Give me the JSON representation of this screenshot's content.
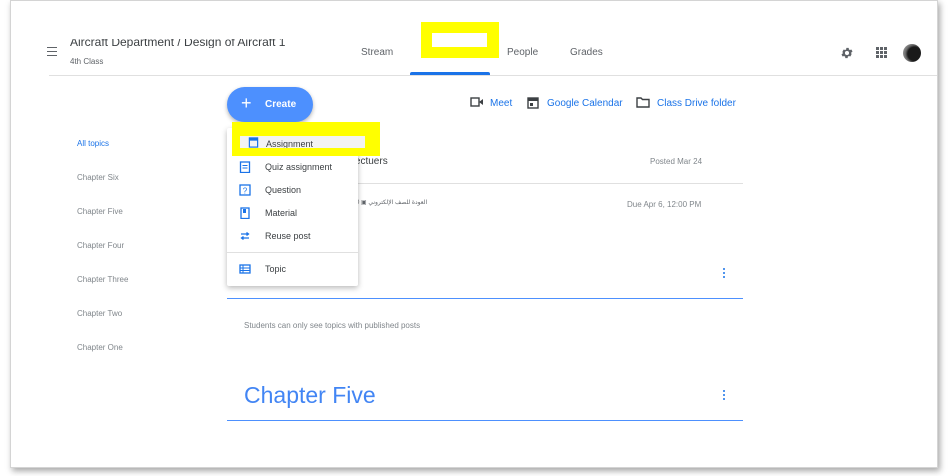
{
  "header": {
    "class_title": "Aircraft Department / Design of Aircraft 1",
    "class_subtitle": "4th Class",
    "tabs": {
      "stream": "Stream",
      "people": "People",
      "grades": "Grades"
    }
  },
  "create": {
    "label": "Create"
  },
  "links": {
    "meet": "Meet",
    "calendar": "Google Calendar",
    "drive": "Class Drive folder"
  },
  "topics": [
    "All topics",
    "Chapter Six",
    "Chapter Five",
    "Chapter Four",
    "Chapter Three",
    "Chapter Two",
    "Chapter One"
  ],
  "menu": {
    "items": [
      {
        "label": "Assignment",
        "icon": "assignment-icon"
      },
      {
        "label": "Quiz assignment",
        "icon": "quiz-icon"
      },
      {
        "label": "Question",
        "icon": "question-icon"
      },
      {
        "label": "Material",
        "icon": "material-icon"
      },
      {
        "label": "Reuse post",
        "icon": "reuse-icon"
      },
      {
        "label": "Topic",
        "icon": "topic-icon"
      }
    ]
  },
  "post": {
    "title_fragment": "o Lectuers",
    "posted": "Posted Mar 24",
    "arabic_line": "العودة للصف الإلكتروني",
    "arabic_count": "0",
    "due": "Due Apr 6, 12:00 PM"
  },
  "notice": "Students can only see topics with published posts",
  "section": {
    "heading": "Chapter Five"
  },
  "colors": {
    "accent": "#1a73e8",
    "create_button": "#4d90fe",
    "highlight": "#ffff00"
  }
}
